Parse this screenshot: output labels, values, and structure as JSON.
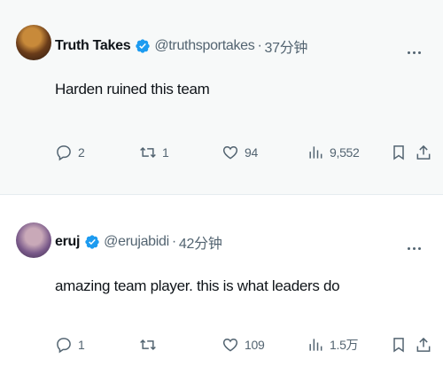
{
  "tweets": [
    {
      "author_name": "Truth Takes",
      "handle": "@truthsportakes",
      "separator": "·",
      "time": "37分钟",
      "text": "Harden ruined this team",
      "replies": "2",
      "retweets": "1",
      "likes": "94",
      "views": "9,552"
    },
    {
      "author_name": "eruj",
      "handle": "@erujabidi",
      "separator": "·",
      "time": "42分钟",
      "text": "amazing team player. this is what leaders do",
      "replies": "1",
      "retweets": "",
      "likes": "109",
      "views": "1.5万"
    }
  ],
  "colors": {
    "verified": "#1d9bf0",
    "muted": "#536471",
    "text": "#0f1419"
  },
  "icons": [
    "verified-badge-icon",
    "more-icon",
    "reply-icon",
    "retweet-icon",
    "like-icon",
    "views-icon",
    "bookmark-icon",
    "share-icon"
  ]
}
